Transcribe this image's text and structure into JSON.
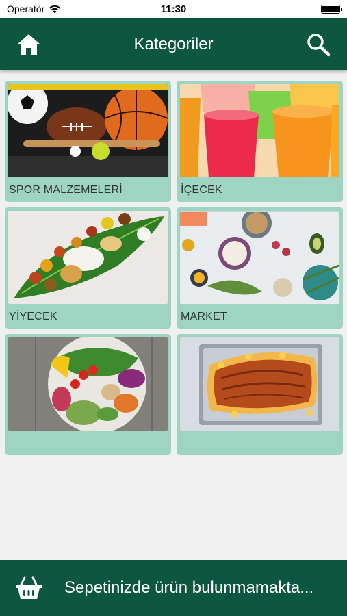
{
  "status": {
    "carrier": "Operatör",
    "time": "11:30"
  },
  "header": {
    "title": "Kategoriler",
    "left_icon": "home-icon",
    "right_icon": "search-icon"
  },
  "categories": [
    {
      "label": "SPOR MALZEMELERİ",
      "image": "sports-equipment-photo"
    },
    {
      "label": "İÇECEK",
      "image": "drinks-photo"
    },
    {
      "label": "YİYECEK",
      "image": "food-platter-photo"
    },
    {
      "label": "MARKET",
      "image": "groceries-photo"
    },
    {
      "label": "",
      "image": "salad-bowl-photo"
    },
    {
      "label": "",
      "image": "baked-fish-photo"
    }
  ],
  "cart": {
    "icon": "basket-icon",
    "text": "Sepetinizde ürün bulunmamakta..."
  },
  "colors": {
    "primary": "#0d5640",
    "card_bg": "#9ed5c2",
    "page_bg": "#f0f0f0"
  }
}
